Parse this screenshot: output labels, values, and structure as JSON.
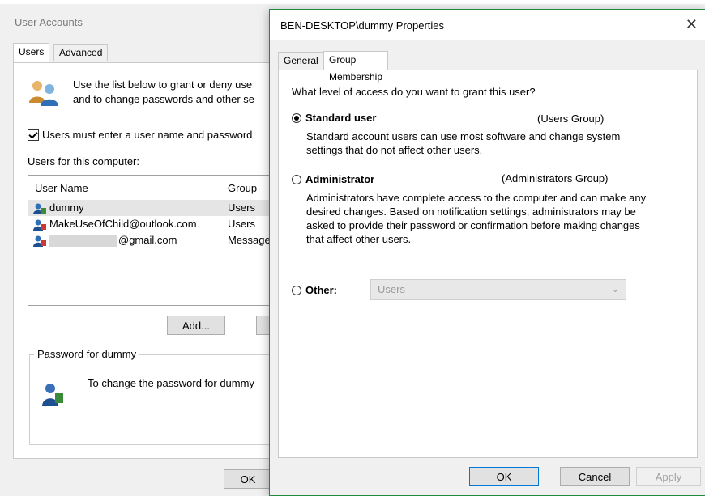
{
  "user_accounts": {
    "title": "User Accounts",
    "tabs": [
      {
        "label": "Users"
      },
      {
        "label": "Advanced"
      }
    ],
    "intro_text": "Use the list below to grant or deny use\nand to change passwords and other se",
    "must_enter_label": "Users must enter a user name and password",
    "users_for_computer_label": "Users for this computer:",
    "columns": {
      "user_name": "User Name",
      "group": "Group"
    },
    "users": [
      {
        "name": "dummy",
        "group": "Users",
        "selected": true
      },
      {
        "name": "MakeUseOfChild@outlook.com",
        "group": "Users",
        "selected": false
      },
      {
        "name": "@gmail.com",
        "group": "Message",
        "selected": false
      }
    ],
    "add_button": "Add...",
    "password_group_label": "Password for dummy",
    "password_text": "To change the password for dummy",
    "ok_button": "OK"
  },
  "properties_dialog": {
    "title": "BEN-DESKTOP\\dummy Properties",
    "tabs": [
      {
        "label": "General"
      },
      {
        "label": "Group Membership"
      }
    ],
    "active_tab": "Group Membership",
    "question": "What level of access do you want to grant this user?",
    "options": {
      "standard": {
        "label": "Standard user",
        "group": "(Users Group)",
        "description": "Standard account users can use most software and change system settings that do not affect other users.",
        "selected": true
      },
      "administrator": {
        "label": "Administrator",
        "group": "(Administrators Group)",
        "description": "Administrators have complete access to the computer and can make any desired changes. Based on notification settings, administrators may be asked to provide their password or confirmation before making changes that affect other users.",
        "selected": false
      },
      "other": {
        "label": "Other:",
        "select_value": "Users",
        "selected": false
      }
    },
    "buttons": {
      "ok": "OK",
      "cancel": "Cancel",
      "apply": "Apply"
    },
    "colors": {
      "border": "#1f8a3c",
      "default_button_border": "#0078d7"
    }
  }
}
